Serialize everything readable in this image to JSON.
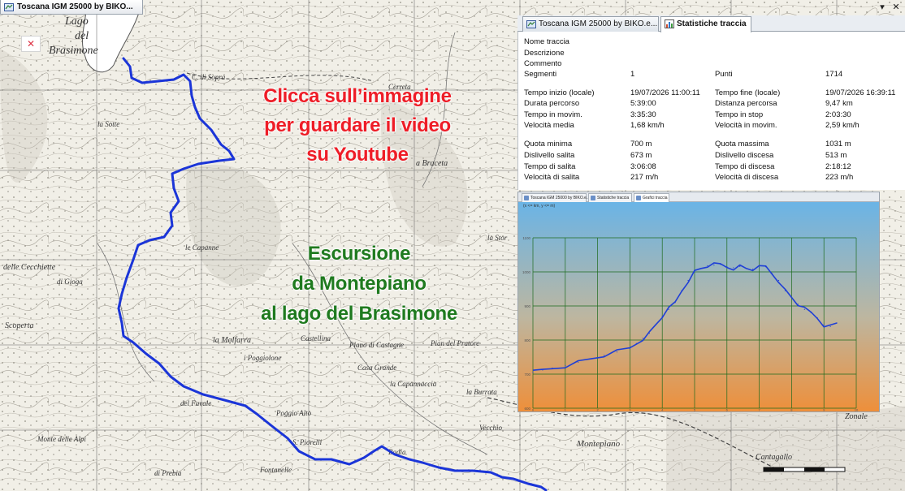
{
  "window": {
    "tab_label": "Toscana IGM 25000 by BIKO...",
    "controls": {
      "dropdown": "▾",
      "close": "✕"
    },
    "close_box": "✕"
  },
  "overlay": {
    "red_lines": [
      "Clicca sull’immagine",
      "per guardare il video",
      "su Youtube"
    ],
    "green_lines": [
      "Escursione",
      "da Montepiano",
      "al lago del Brasimone"
    ]
  },
  "map": {
    "labels": [
      {
        "text": "Lago",
        "name": "map-label-lago"
      },
      {
        "text": "del",
        "name": "map-label-del"
      },
      {
        "text": "Brasimone",
        "name": "map-label-brasimone"
      },
      {
        "text": "C. di Sopra",
        "name": "map-label-cdisopra"
      },
      {
        "text": "la Sotte",
        "name": "map-label-lasotte"
      },
      {
        "text": "Cerreta",
        "name": "map-label-cerreta"
      },
      {
        "text": "a Braceta",
        "name": "map-label-braceta"
      },
      {
        "text": "delle Cecchiette",
        "name": "map-label-cecchiette"
      },
      {
        "text": "di Gioga",
        "name": "map-label-gioga"
      },
      {
        "text": "Scoperta",
        "name": "map-label-scoperta"
      },
      {
        "text": "la Molfarra",
        "name": "map-label-molfarra"
      },
      {
        "text": "le Capanne",
        "name": "map-label-capanne"
      },
      {
        "text": "Castellina",
        "name": "map-label-castellina"
      },
      {
        "text": "Piano di Castagne",
        "name": "map-label-piano"
      },
      {
        "text": "i Poggiolone",
        "name": "map-label-poggiolone"
      },
      {
        "text": "Casa Grande",
        "name": "map-label-casagrande"
      },
      {
        "text": "del Favale",
        "name": "map-label-favale"
      },
      {
        "text": "la Capannaccia",
        "name": "map-label-capannaccia"
      },
      {
        "text": "Pian del Pratore",
        "name": "map-label-pratore"
      },
      {
        "text": "la Burrata",
        "name": "map-label-burrata"
      },
      {
        "text": "Montepiano",
        "name": "map-label-montepiano"
      },
      {
        "text": "Vecchio",
        "name": "map-label-vecchio"
      },
      {
        "text": "Fontanelle",
        "name": "map-label-fontanelle"
      },
      {
        "text": "Poggio Alto",
        "name": "map-label-poggioalto"
      },
      {
        "text": "Badia",
        "name": "map-label-badia"
      },
      {
        "text": "Cantagallo",
        "name": "map-label-cantagallo"
      },
      {
        "text": "Zonale",
        "name": "map-label-zonale"
      },
      {
        "text": "S. Piorelli",
        "name": "map-label-spiorelli"
      },
      {
        "text": "di Prebia",
        "name": "map-label-prebia"
      },
      {
        "text": "Monte delle Alpi",
        "name": "map-label-alpi"
      },
      {
        "text": "la Stor",
        "name": "map-label-stor"
      }
    ]
  },
  "stats": {
    "tabs": [
      {
        "label": "Toscana IGM 25000 by BIKO.e...",
        "active": false
      },
      {
        "label": "Statistiche traccia",
        "active": true
      }
    ],
    "info": [
      {
        "label": "Nome traccia"
      },
      {
        "label": "Descrizione"
      },
      {
        "label": "Commento"
      }
    ],
    "rows": [
      {
        "l1": "Segmenti",
        "v1": "1",
        "l2": "Punti",
        "v2": "1714"
      },
      {
        "l1": "Tempo inizio (locale)",
        "v1": "19/07/2026 11:00:11",
        "l2": "Tempo fine (locale)",
        "v2": "19/07/2026 16:39:11"
      },
      {
        "l1": "Durata percorso",
        "v1": "5:39:00",
        "l2": "Distanza percorsa",
        "v2": "9,47 km"
      },
      {
        "l1": "Tempo in movim.",
        "v1": "3:35:30",
        "l2": "Tempo in stop",
        "v2": "2:03:30"
      },
      {
        "l1": "Velocità media",
        "v1": "1,68 km/h",
        "l2": "Velocità in movim.",
        "v2": "2,59 km/h"
      },
      {
        "l1": "Quota minima",
        "v1": "700 m",
        "l2": "Quota massima",
        "v2": "1031 m"
      },
      {
        "l1": "Dislivello salita",
        "v1": "673 m",
        "l2": "Dislivello discesa",
        "v2": "513 m"
      },
      {
        "l1": "Tempo di salita",
        "v1": "3:06:08",
        "l2": "Tempo di discesa",
        "v2": "2:18:12"
      },
      {
        "l1": "Velocità di salita",
        "v1": "217 m/h",
        "l2": "Velocità di discesa",
        "v2": "223 m/h"
      }
    ]
  },
  "graph": {
    "tabs": [
      {
        "label": "Toscana IGM 25000 by BIKO.e...",
        "active": false
      },
      {
        "label": "Statistiche traccia",
        "active": false
      },
      {
        "label": "Grafici traccia",
        "active": true
      }
    ],
    "axes_note": "(x <= km, y <= m)"
  },
  "chart_data": {
    "type": "line",
    "xlim": [
      0,
      10
    ],
    "ylim": [
      600,
      1100
    ],
    "y_ticks": [
      "600",
      "700",
      "800",
      "900",
      "1000",
      "1100"
    ],
    "x_ticks": [
      "0",
      "1",
      "2",
      "3",
      "4",
      "5",
      "6",
      "7",
      "8",
      "9",
      "10"
    ],
    "grid": true,
    "series": [
      {
        "color": "#1f3fd6",
        "x": [
          0,
          0.3,
          0.6,
          1.0,
          1.4,
          1.8,
          2.2,
          2.6,
          3.0,
          3.2,
          3.4,
          3.6,
          3.8,
          4.0,
          4.2,
          4.4,
          4.6,
          4.8,
          5.0,
          5.2,
          5.4,
          5.6,
          5.8,
          6.0,
          6.2,
          6.4,
          6.6,
          6.8,
          7.0,
          7.2,
          7.4,
          7.6,
          7.8,
          8.0,
          8.2,
          8.4,
          8.6,
          8.8,
          9.0,
          9.2,
          9.4
        ],
        "y": [
          705,
          712,
          718,
          725,
          735,
          745,
          755,
          765,
          775,
          790,
          805,
          820,
          845,
          870,
          890,
          910,
          945,
          975,
          1000,
          1010,
          1018,
          1020,
          1022,
          1015,
          1012,
          1016,
          1010,
          1008,
          1012,
          1015,
          995,
          975,
          945,
          925,
          905,
          890,
          880,
          865,
          845,
          840,
          850
        ]
      }
    ]
  }
}
